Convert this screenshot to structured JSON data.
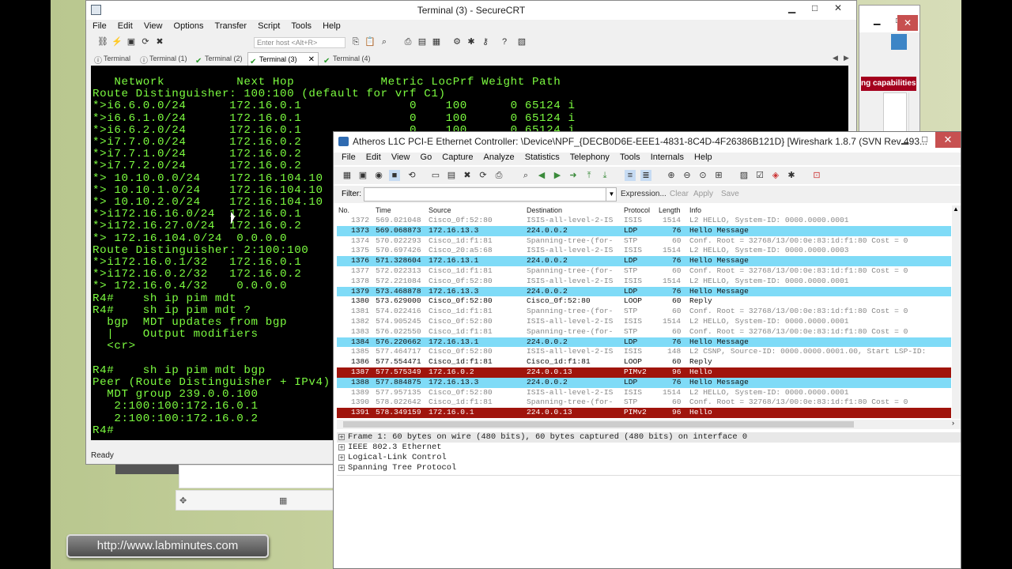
{
  "securecrt": {
    "title": "Terminal (3) - SecureCRT",
    "menu": [
      "File",
      "Edit",
      "View",
      "Options",
      "Transfer",
      "Script",
      "Tools",
      "Help"
    ],
    "host_placeholder": "Enter host <Alt+R>",
    "tabs": [
      {
        "label": "Terminal",
        "active": false
      },
      {
        "label": "Terminal (1)",
        "active": false
      },
      {
        "label": "Terminal (2)",
        "active": false
      },
      {
        "label": "Terminal (3)",
        "active": true
      },
      {
        "label": "Terminal (4)",
        "active": false
      }
    ],
    "terminal_lines": [
      "   Network          Next Hop            Metric LocPrf Weight Path",
      "Route Distinguisher: 100:100 (default for vrf C1)",
      "*>i6.6.0.0/24      172.16.0.1               0    100      0 65124 i",
      "*>i6.6.1.0/24      172.16.0.1               0    100      0 65124 i",
      "*>i6.6.2.0/24      172.16.0.1               0    100      0 65124 i",
      "*>i7.7.0.0/24      172.16.0.2",
      "*>i7.7.1.0/24      172.16.0.2",
      "*>i7.7.2.0/24      172.16.0.2",
      "*> 10.10.0.0/24    172.16.104.10",
      "*> 10.10.1.0/24    172.16.104.10",
      "*> 10.10.2.0/24    172.16.104.10",
      "*>i172.16.16.0/24  172.16.0.1",
      "*>i172.16.27.0/24  172.16.0.2",
      "*> 172.16.104.0/24  0.0.0.0",
      "Route Distinguisher: 2:100:100",
      "*>i172.16.0.1/32   172.16.0.1",
      "*>i172.16.0.2/32   172.16.0.2",
      "*> 172.16.0.4/32    0.0.0.0",
      "R4#    sh ip pim mdt",
      "R4#    sh ip pim mdt ?",
      "  bgp  MDT updates from bgp",
      "  |    Output modifiers",
      "  <cr>",
      "",
      "R4#    sh ip pim mdt bgp",
      "Peer (Route Distinguisher + IPv4)",
      "  MDT group 239.0.0.100",
      "   2:100:100:172.16.0.1",
      "   2:100:100:172.16.0.2",
      "R4#"
    ],
    "status": "Ready"
  },
  "wireshark": {
    "title": "Atheros L1C PCI-E Ethernet Controller: \\Device\\NPF_{DECB0D6E-EEE1-4831-8C4D-4F26386B121D}   [Wireshark 1.8.7  (SVN Rev 493...",
    "menu": [
      "File",
      "Edit",
      "View",
      "Go",
      "Capture",
      "Analyze",
      "Statistics",
      "Telephony",
      "Tools",
      "Internals",
      "Help"
    ],
    "filter": {
      "label": "Filter:",
      "expression": "Expression...",
      "clear": "Clear",
      "apply": "Apply",
      "save": "Save"
    },
    "columns": [
      "No.",
      "Time",
      "Source",
      "Destination",
      "Protocol",
      "Length",
      "Info"
    ],
    "packets": [
      {
        "no": "1372",
        "time": "569.021048",
        "src": "Cisco_0f:52:80",
        "dst": "ISIS-all-level-2-IS",
        "proto": "ISIS",
        "len": "1514",
        "info": "L2 HELLO, System-ID: 0000.0000.0001",
        "style": "plain"
      },
      {
        "no": "1373",
        "time": "569.068873",
        "src": "172.16.13.3",
        "dst": "224.0.0.2",
        "proto": "LDP",
        "len": "76",
        "info": "Hello Message",
        "style": "hello"
      },
      {
        "no": "1374",
        "time": "570.022293",
        "src": "Cisco_1d:f1:81",
        "dst": "Spanning-tree-(for-",
        "proto": "STP",
        "len": "60",
        "info": "Conf. Root = 32768/13/00:0e:83:1d:f1:80   Cost = 0",
        "style": "plain"
      },
      {
        "no": "1375",
        "time": "570.697426",
        "src": "Cisco_20:a5:68",
        "dst": "ISIS-all-level-2-IS",
        "proto": "ISIS",
        "len": "1514",
        "info": "L2 HELLO, System-ID: 0000.0000.0003",
        "style": "plain"
      },
      {
        "no": "1376",
        "time": "571.328604",
        "src": "172.16.13.1",
        "dst": "224.0.0.2",
        "proto": "LDP",
        "len": "76",
        "info": "Hello Message",
        "style": "hello"
      },
      {
        "no": "1377",
        "time": "572.022313",
        "src": "Cisco_1d:f1:81",
        "dst": "Spanning-tree-(for-",
        "proto": "STP",
        "len": "60",
        "info": "Conf. Root = 32768/13/00:0e:83:1d:f1:80   Cost = 0",
        "style": "plain"
      },
      {
        "no": "1378",
        "time": "572.221084",
        "src": "Cisco_0f:52:80",
        "dst": "ISIS-all-level-2-IS",
        "proto": "ISIS",
        "len": "1514",
        "info": "L2 HELLO, System-ID: 0000.0000.0001",
        "style": "plain"
      },
      {
        "no": "1379",
        "time": "573.468878",
        "src": "172.16.13.3",
        "dst": "224.0.0.2",
        "proto": "LDP",
        "len": "76",
        "info": "Hello Message",
        "style": "hello"
      },
      {
        "no": "1380",
        "time": "573.629000",
        "src": "Cisco_0f:52:80",
        "dst": "Cisco_0f:52:80",
        "proto": "LOOP",
        "len": "60",
        "info": "Reply",
        "style": "dark"
      },
      {
        "no": "1381",
        "time": "574.022416",
        "src": "Cisco_1d:f1:81",
        "dst": "Spanning-tree-(for-",
        "proto": "STP",
        "len": "60",
        "info": "Conf. Root = 32768/13/00:0e:83:1d:f1:80   Cost = 0",
        "style": "plain"
      },
      {
        "no": "1382",
        "time": "574.905245",
        "src": "Cisco_0f:52:80",
        "dst": "ISIS-all-level-2-IS",
        "proto": "ISIS",
        "len": "1514",
        "info": "L2 HELLO, System-ID: 0000.0000.0001",
        "style": "plain"
      },
      {
        "no": "1383",
        "time": "576.022550",
        "src": "Cisco_1d:f1:81",
        "dst": "Spanning-tree-(for-",
        "proto": "STP",
        "len": "60",
        "info": "Conf. Root = 32768/13/00:0e:83:1d:f1:80   Cost = 0",
        "style": "plain"
      },
      {
        "no": "1384",
        "time": "576.220662",
        "src": "172.16.13.1",
        "dst": "224.0.0.2",
        "proto": "LDP",
        "len": "76",
        "info": "Hello Message",
        "style": "hello"
      },
      {
        "no": "1385",
        "time": "577.464717",
        "src": "Cisco_0f:52:80",
        "dst": "ISIS-all-level-2-IS",
        "proto": "ISIS",
        "len": "148",
        "info": "L2 CSNP, Source-ID: 0000.0000.0001.00, Start LSP-ID:",
        "style": "plain"
      },
      {
        "no": "1386",
        "time": "577.554471",
        "src": "Cisco_1d:f1:81",
        "dst": "Cisco_1d:f1:81",
        "proto": "LOOP",
        "len": "60",
        "info": "Reply",
        "style": "dark"
      },
      {
        "no": "1387",
        "time": "577.575349",
        "src": "172.16.0.2",
        "dst": "224.0.0.13",
        "proto": "PIMv2",
        "len": "96",
        "info": "Hello",
        "style": "pim"
      },
      {
        "no": "1388",
        "time": "577.884875",
        "src": "172.16.13.3",
        "dst": "224.0.0.2",
        "proto": "LDP",
        "len": "76",
        "info": "Hello Message",
        "style": "hello"
      },
      {
        "no": "1389",
        "time": "577.957135",
        "src": "Cisco_0f:52:80",
        "dst": "ISIS-all-level-2-IS",
        "proto": "ISIS",
        "len": "1514",
        "info": "L2 HELLO, System-ID: 0000.0000.0001",
        "style": "plain"
      },
      {
        "no": "1390",
        "time": "578.022642",
        "src": "Cisco_1d:f1:81",
        "dst": "Spanning-tree-(for-",
        "proto": "STP",
        "len": "60",
        "info": "Conf. Root = 32768/13/00:0e:83:1d:f1:80   Cost = 0",
        "style": "plain"
      },
      {
        "no": "1391",
        "time": "578.349159",
        "src": "172.16.0.1",
        "dst": "224.0.0.13",
        "proto": "PIMv2",
        "len": "96",
        "info": "Hello",
        "style": "pim"
      }
    ],
    "details": [
      "Frame 1: 60 bytes on wire (480 bits), 60 bytes captured (480 bits) on interface 0",
      "IEEE 802.3 Ethernet",
      "Logical-Link Control",
      "Spanning Tree Protocol"
    ]
  },
  "background_window": {
    "banner": "ng capabilities"
  },
  "watermark": {
    "url": "http://www.labminutes.com"
  },
  "colors": {
    "terminal_text": "#7cfc40",
    "hello_row": "#7fdbf7",
    "pim_row": "#a0140c",
    "close_button": "#c75050"
  }
}
